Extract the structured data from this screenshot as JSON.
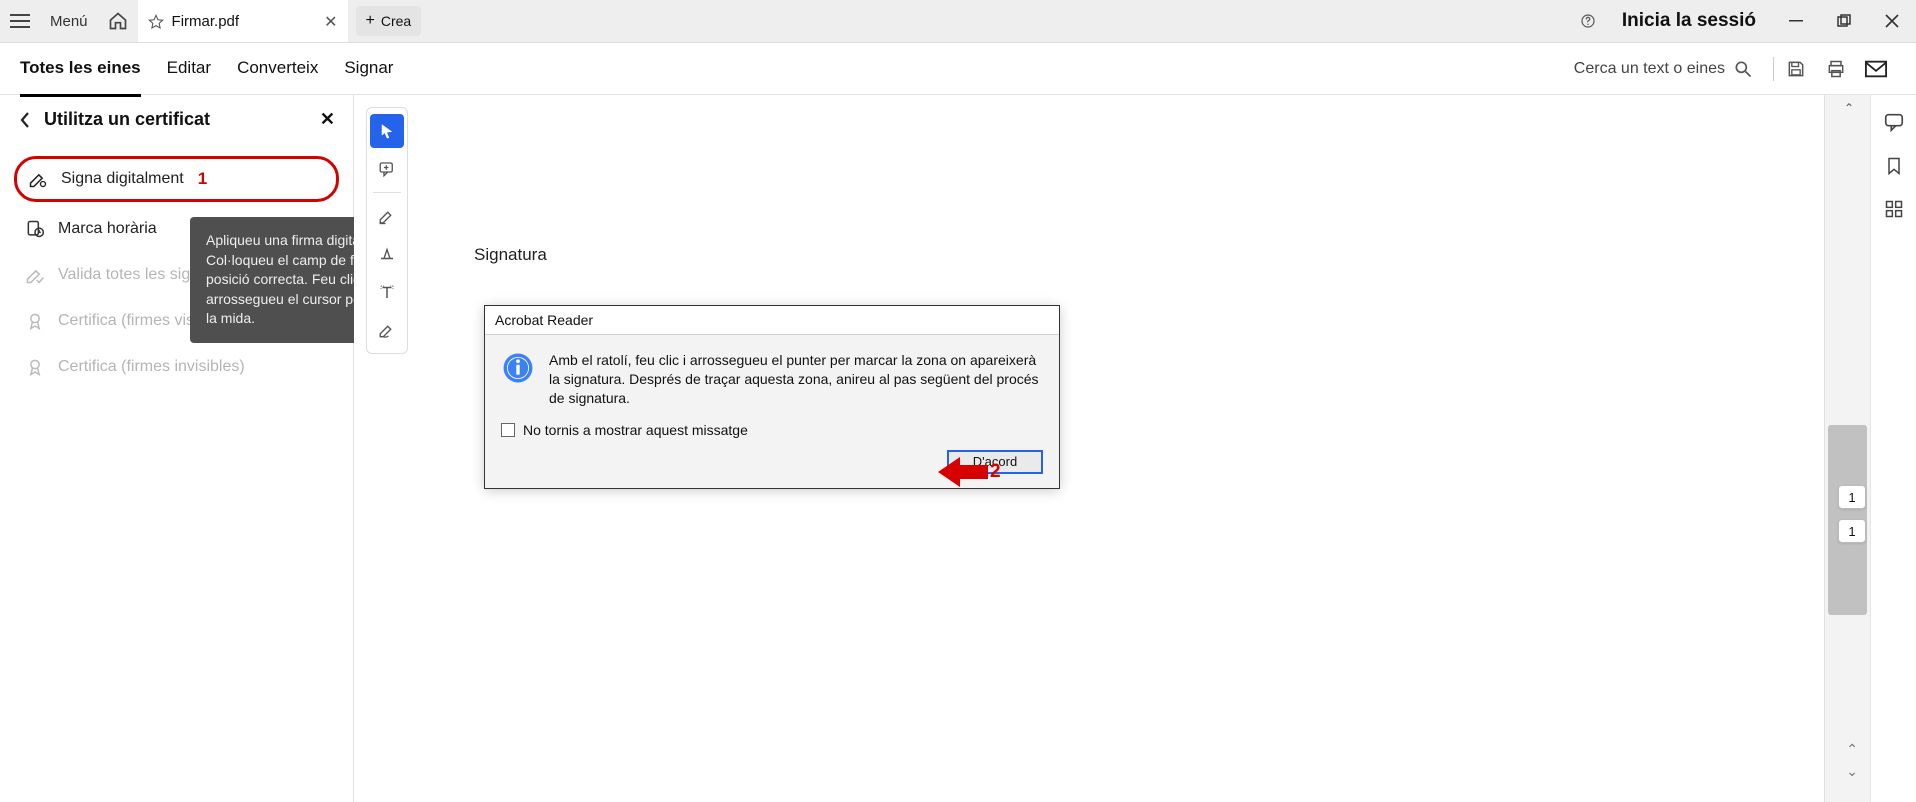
{
  "titlebar": {
    "menu_label": "Menú",
    "tab_title": "Firmar.pdf",
    "newtab_label": "Crea",
    "signin_label": "Inicia la sessió"
  },
  "maintools": {
    "items": [
      "Totes les eines",
      "Editar",
      "Converteix",
      "Signar"
    ],
    "search_placeholder": "Cerca un text o eines"
  },
  "leftpanel": {
    "title": "Utilitza un certificat",
    "items": [
      {
        "label": "Signa digitalment"
      },
      {
        "label": "Marca horària"
      },
      {
        "label": "Valida totes les signatures"
      },
      {
        "label": "Certifica (firmes visibles)"
      },
      {
        "label": "Certifica (firmes invisibles)"
      }
    ]
  },
  "tooltip": {
    "badge": "i",
    "text": "Apliqueu una firma digital visible. Col·loqueu el camp de firma en la posició correcta. Feu clic i arrossegueu el cursor per canviar-ne la mida."
  },
  "document": {
    "signature_label": "Signatura"
  },
  "dialog": {
    "title": "Acrobat Reader",
    "body": "Amb el ratolí, feu clic i arrossegueu el punter per marcar la zona on apareixerà la signatura. Després de traçar aquesta zona, anireu al pas següent del procés de signatura.",
    "dont_show_label": "No tornis a mostrar aquest missatge",
    "ok_label": "D'acord"
  },
  "annotations": {
    "step2": "2"
  },
  "pagenav": {
    "current": "1",
    "total": "1"
  }
}
